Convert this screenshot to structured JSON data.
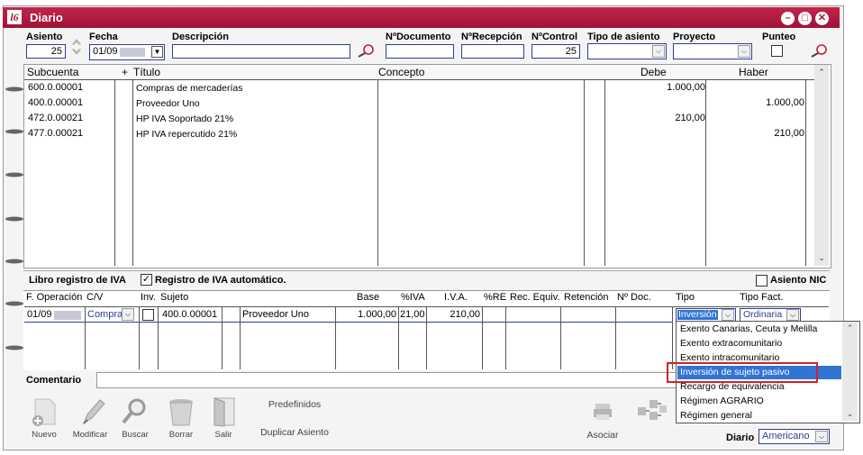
{
  "window": {
    "title": "Diario",
    "logo": "l6-logo"
  },
  "header": {
    "asiento_label": "Asiento",
    "asiento_value": "25",
    "fecha_label": "Fecha",
    "fecha_value": "01/09",
    "descripcion_label": "Descripción",
    "descripcion_value": "",
    "ndocumento_label": "NºDocumento",
    "ndocumento_value": "",
    "nrecepcion_label": "NºRecepción",
    "nrecepcion_value": "",
    "ncontrol_label": "NºControl",
    "ncontrol_value": "25",
    "tipo_asiento_label": "Tipo de asiento",
    "tipo_asiento_value": "",
    "proyecto_label": "Proyecto",
    "proyecto_value": "",
    "punteo_label": "Punteo"
  },
  "grid": {
    "headers": {
      "subcuenta": "Subcuenta",
      "plus": "+",
      "titulo": "Título",
      "concepto": "Concepto",
      "debe": "Debe",
      "haber": "Haber"
    },
    "rows": [
      {
        "subcuenta": "600.0.00001",
        "titulo": "Compras de mercaderías",
        "concepto": "",
        "debe": "1.000,00",
        "haber": ""
      },
      {
        "subcuenta": "400.0.00001",
        "titulo": "Proveedor Uno",
        "concepto": "",
        "debe": "",
        "haber": "1.000,00"
      },
      {
        "subcuenta": "472.0.00021",
        "titulo": "HP IVA Soportado 21%",
        "concepto": "",
        "debe": "210,00",
        "haber": ""
      },
      {
        "subcuenta": "477.0.00021",
        "titulo": "HP IVA repercutido 21%",
        "concepto": "",
        "debe": "",
        "haber": "210,00"
      }
    ]
  },
  "iva": {
    "libro_label": "Libro registro de IVA",
    "auto_label": "Registro de IVA automático.",
    "auto_checked": true,
    "nic_label": "Asiento NIC",
    "headers": {
      "foperacion": "F. Operación",
      "cv": "C/V",
      "inv": "Inv.",
      "sujeto": "Sujeto",
      "base": "Base",
      "piva": "%IVA",
      "iva": "I.V.A.",
      "pre": "%RE",
      "recequiv": "Rec. Equiv.",
      "retencion": "Retención",
      "ndoc": "Nº Doc.",
      "tipo": "Tipo",
      "tipofact": "Tipo Fact."
    },
    "row": {
      "foperacion": "01/09",
      "cv": "Compra",
      "sujeto": "400.0.00001",
      "nombre": "Proveedor Uno",
      "base": "1.000,00",
      "piva": "21,00",
      "iva": "210,00",
      "tipo": "Inversión",
      "tipofact": "Ordinaria"
    }
  },
  "dropdown": {
    "items": [
      "Exento Canarias, Ceuta y Melilla",
      "Exento extracomunitario",
      "Exento intracomunitario",
      "Inversión de sujeto pasivo",
      "Recargo de equivalencia",
      "Régimen AGRARIO",
      "Régimen general"
    ],
    "selected_index": 3
  },
  "comentario": {
    "label": "Comentario",
    "value": ""
  },
  "toolbar": {
    "nuevo": "Nuevo",
    "modificar": "Modificar",
    "buscar": "Buscar",
    "borrar": "Borrar",
    "salir": "Salir",
    "predefinidos": "Predefinidos",
    "duplicar": "Duplicar Asiento",
    "asociar": "Asociar"
  },
  "diario": {
    "label": "Diario",
    "value": "Americano"
  },
  "colors": {
    "titlebar": "#a2173a",
    "selection": "#3175d3",
    "highlight_box": "#d0212b",
    "input_border": "#2c3e90"
  }
}
